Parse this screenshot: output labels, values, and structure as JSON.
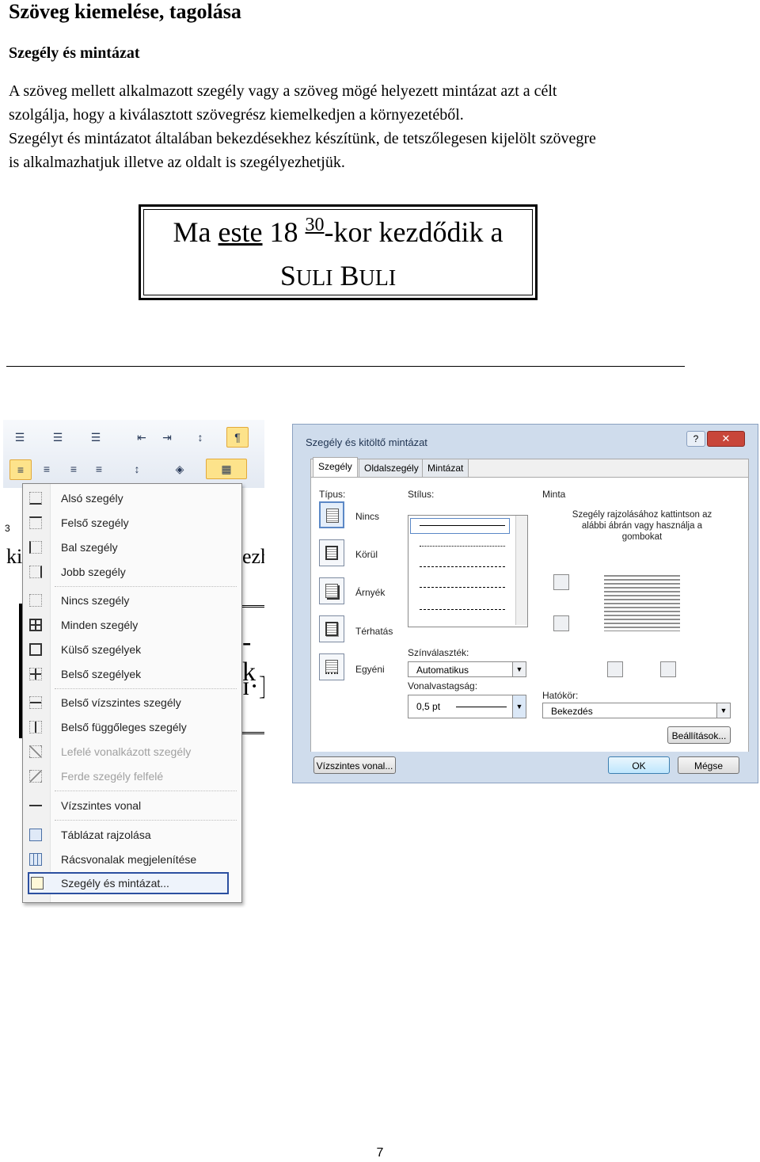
{
  "heading": "Szöveg kiemelése, tagolása",
  "subheading": "Szegély és mintázat",
  "paragraph": {
    "lines": [
      "A szöveg mellett alkalmazott szegély vagy a szöveg mögé helyezett mintázat azt a célt",
      "szolgálja, hogy a kiválasztott szövegrész kiemelkedjen a környezetéből.",
      "Szegélyt és mintázatot általában bekezdésekhez készítünk, de tetszőlegesen kijelölt szövegre",
      "is alkalmazhatjuk illetve az oldalt is szegélyezhetjük."
    ]
  },
  "example_box": {
    "line1_pre": "Ma ",
    "line1_underlined": "este",
    "line1_mid": " 18 ",
    "line1_sup": "30",
    "line1_post": "-kor kezdődik a",
    "line2_word1_cap": "S",
    "line2_word1_rest": "ULI",
    "line2_word2_cap": "B",
    "line2_word2_rest": "ULI"
  },
  "border_menu": {
    "items": [
      {
        "label": "Alsó szegély",
        "icon": "bottom-border-icon"
      },
      {
        "label": "Felső szegély",
        "icon": "top-border-icon"
      },
      {
        "label": "Bal szegély",
        "icon": "left-border-icon"
      },
      {
        "label": "Jobb szegély",
        "icon": "right-border-icon"
      },
      {
        "label": "Nincs szegély",
        "icon": "no-border-icon"
      },
      {
        "label": "Minden szegély",
        "icon": "all-borders-icon"
      },
      {
        "label": "Külső szegélyek",
        "icon": "outside-borders-icon"
      },
      {
        "label": "Belső szegélyek",
        "icon": "inside-borders-icon"
      },
      {
        "label": "Belső vízszintes szegély",
        "icon": "inside-horizontal-border-icon"
      },
      {
        "label": "Belső függőleges szegély",
        "icon": "inside-vertical-border-icon"
      },
      {
        "label": "Lefelé vonalkázott szegély",
        "icon": "diagonal-down-border-icon",
        "disabled": true
      },
      {
        "label": "Ferde szegély felfelé",
        "icon": "diagonal-up-border-icon",
        "disabled": true
      },
      {
        "label": "Vízszintes vonal",
        "icon": "horizontal-line-icon"
      },
      {
        "label": "Táblázat rajzolása",
        "icon": "draw-table-icon"
      },
      {
        "label": "Rácsvonalak megjelenítése",
        "icon": "view-gridlines-icon"
      },
      {
        "label": "Szegély és mintázat...",
        "icon": "borders-shading-icon"
      }
    ]
  },
  "ruler_mark": "3",
  "dialog": {
    "title": "Szegély és kitöltő mintázat",
    "help": "?",
    "close": "✕",
    "tabs": [
      "Szegély",
      "Oldalszegély",
      "Mintázat"
    ],
    "type_label": "Típus:",
    "types": [
      "Nincs",
      "Körül",
      "Árnyék",
      "Térhatás",
      "Egyéni"
    ],
    "style_label": "Stílus:",
    "color_label": "Színválaszték:",
    "color_value": "Automatikus",
    "width_label": "Vonalvastagság:",
    "width_value": "0,5 pt",
    "preview_label": "Minta",
    "preview_note": "Szegély rajzolásához kattintson az alábbi ábrán vagy használja a gombokat",
    "apply_label": "Hatókör:",
    "apply_value": "Bekezdés",
    "options_btn": "Beállítások...",
    "hline_btn": "Vízszintes vonal...",
    "ok_btn": "OK",
    "cancel_btn": "Mégse"
  },
  "page_number": "7"
}
